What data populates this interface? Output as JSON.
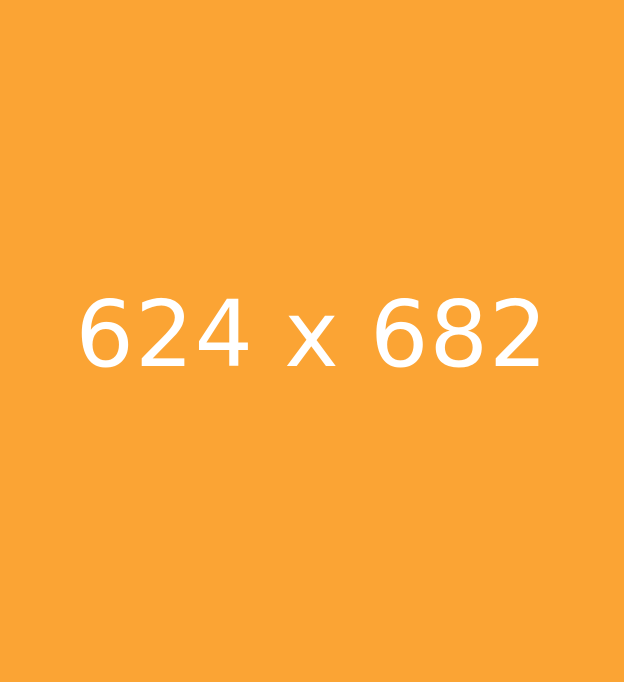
{
  "placeholder": {
    "text": "624 x 682",
    "background_color": "#FBA434",
    "text_color": "#FFFFFF"
  }
}
